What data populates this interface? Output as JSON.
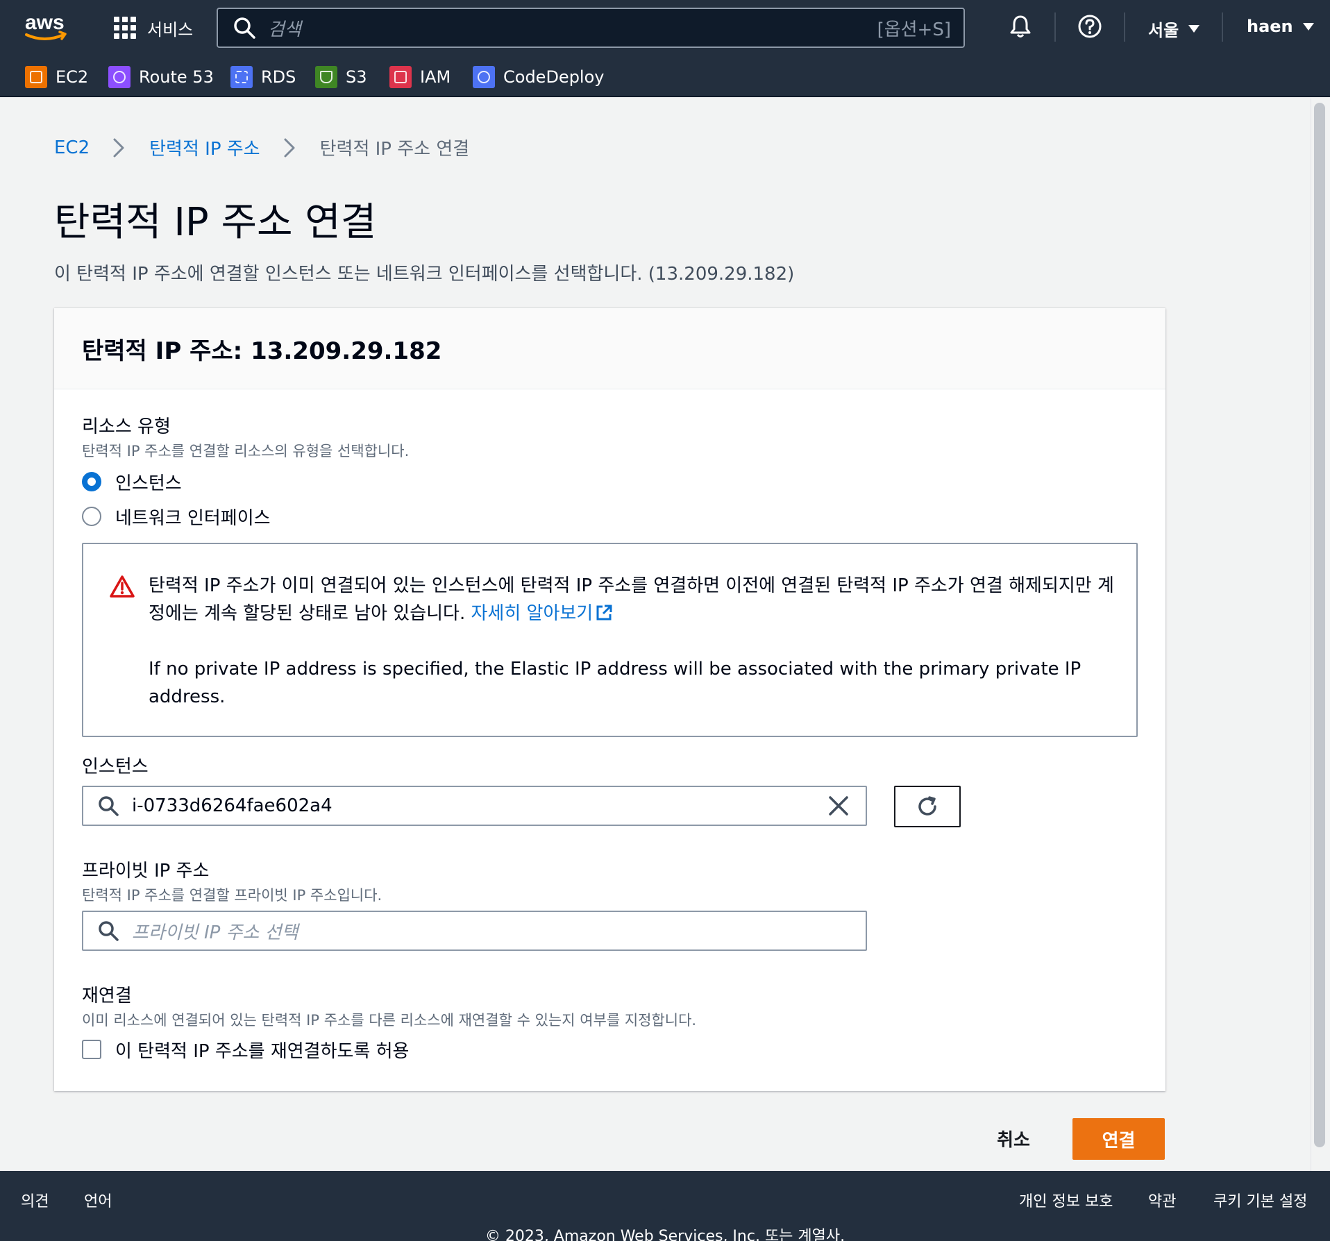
{
  "topbar": {
    "services_label": "서비스",
    "search_placeholder": "검색",
    "search_shortcut": "[옵션+S]",
    "region": "서울",
    "user": "haen"
  },
  "favorites": [
    {
      "label": "EC2",
      "color": "#ed7100"
    },
    {
      "label": "Route 53",
      "color": "#8c4fff"
    },
    {
      "label": "RDS",
      "color": "#4d72f3"
    },
    {
      "label": "S3",
      "color": "#3f8624"
    },
    {
      "label": "IAM",
      "color": "#dd344c"
    },
    {
      "label": "CodeDeploy",
      "color": "#4d72f3"
    }
  ],
  "breadcrumb": {
    "items": [
      "EC2",
      "탄력적 IP 주소",
      "탄력적 IP 주소 연결"
    ]
  },
  "page": {
    "title": "탄력적 IP 주소 연결",
    "description": "이 탄력적 IP 주소에 연결할 인스턴스 또는 네트워크 인터페이스를 선택합니다. (13.209.29.182)"
  },
  "container": {
    "header": "탄력적 IP 주소: 13.209.29.182"
  },
  "resource_type": {
    "label": "리소스 유형",
    "description": "탄력적 IP 주소를 연결할 리소스의 유형을 선택합니다.",
    "options": [
      {
        "label": "인스턴스",
        "selected": true
      },
      {
        "label": "네트워크 인터페이스",
        "selected": false
      }
    ]
  },
  "alert": {
    "line1": "탄력적 IP 주소가 이미 연결되어 있는 인스턴스에 탄력적 IP 주소를 연결하면 이전에 연결된 탄력적 IP 주소가 연결 해제되지만 계정에는 계속 할당된 상태로 남아 있습니다. ",
    "link": "자세히 알아보기",
    "line2": "If no private IP address is specified, the Elastic IP address will be associated with the primary private IP address."
  },
  "instance": {
    "label": "인스턴스",
    "value": "i-0733d6264fae602a4"
  },
  "private_ip": {
    "label": "프라이빗 IP 주소",
    "description": "탄력적 IP 주소를 연결할 프라이빗 IP 주소입니다.",
    "placeholder": "프라이빗 IP 주소 선택"
  },
  "reassociation": {
    "label": "재연결",
    "description": "이미 리소스에 연결되어 있는 탄력적 IP 주소를 다른 리소스에 재연결할 수 있는지 여부를 지정합니다.",
    "checkbox_label": "이 탄력적 IP 주소를 재연결하도록 허용",
    "checked": false
  },
  "actions": {
    "cancel": "취소",
    "submit": "연결"
  },
  "footer": {
    "feedback": "의견",
    "language": "언어",
    "privacy": "개인 정보 보호",
    "terms": "약관",
    "cookies": "쿠키 기본 설정",
    "copyright": "© 2023, Amazon Web Services, Inc. 또는 계열사."
  },
  "colors": {
    "nav_bg": "#232f3e",
    "link": "#0972d3",
    "primary": "#ec7211",
    "warning": "#d91515"
  }
}
